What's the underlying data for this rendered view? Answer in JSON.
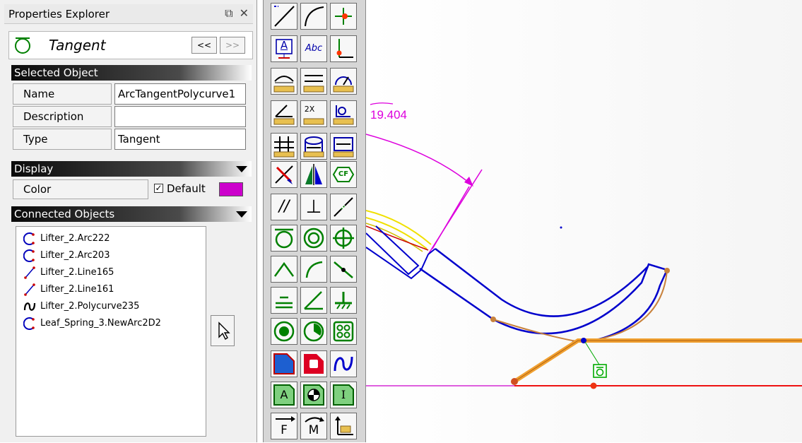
{
  "panel": {
    "title": "Properties Explorer",
    "constraint_name": "Tangent",
    "nav_prev": "<<",
    "nav_next": ">>",
    "sections": {
      "selected_object": "Selected Object",
      "display": "Display",
      "connected_objects": "Connected Objects"
    },
    "fields": [
      {
        "label": "Name",
        "value": "ArcTangentPolycurve1"
      },
      {
        "label": "Description",
        "value": ""
      },
      {
        "label": "Type",
        "value": "Tangent"
      }
    ],
    "color": {
      "label": "Color",
      "default_label": "Default",
      "checked": true,
      "swatch": "#cc00cc"
    },
    "connected": [
      {
        "label": "Lifter_2.Arc222",
        "icon": "arc-icon"
      },
      {
        "label": "Lifter_2.Arc203",
        "icon": "arc-icon"
      },
      {
        "label": "Lifter_2.Line165",
        "icon": "line-icon"
      },
      {
        "label": "Lifter_2.Line161",
        "icon": "line-icon"
      },
      {
        "label": "Lifter_2.Polycurve235",
        "icon": "polycurve-icon",
        "highlighted": true
      },
      {
        "label": "Leaf_Spring_3.NewArc2D2",
        "icon": "arc-icon"
      }
    ]
  },
  "toolbar": {
    "text_tool": "A",
    "abc_tool": "Abc",
    "double_label": "2X",
    "cf_label": "CF",
    "parallel_label": "//",
    "perp_label": "⊥",
    "force_label": "F",
    "moment_label": "M",
    "text_a_label": "A",
    "info_label": "I"
  },
  "canvas": {
    "dimension_value": "19.404",
    "colors": {
      "dimension": "#dd00dd",
      "part": "#0000cc",
      "path": "#c8823c",
      "spring": "#f0a030",
      "ground": "#ff0000",
      "constraint": "#00aa00"
    }
  }
}
